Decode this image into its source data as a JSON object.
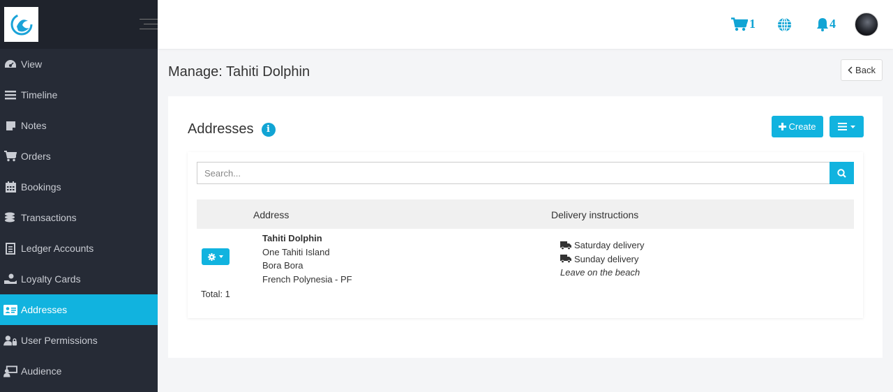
{
  "sidebar": {
    "items": [
      {
        "label": "View",
        "icon": "dashboard-icon"
      },
      {
        "label": "Timeline",
        "icon": "timeline-icon"
      },
      {
        "label": "Notes",
        "icon": "note-icon"
      },
      {
        "label": "Orders",
        "icon": "cart-icon"
      },
      {
        "label": "Bookings",
        "icon": "calendar-icon"
      },
      {
        "label": "Transactions",
        "icon": "coins-icon"
      },
      {
        "label": "Ledger Accounts",
        "icon": "ledger-icon"
      },
      {
        "label": "Loyalty Cards",
        "icon": "loyalty-icon"
      },
      {
        "label": "Addresses",
        "icon": "address-card-icon",
        "active": true
      },
      {
        "label": "User Permissions",
        "icon": "user-lock-icon"
      },
      {
        "label": "Audience",
        "icon": "audience-icon"
      }
    ]
  },
  "topbar": {
    "cart_count": "1",
    "notification_count": "4"
  },
  "page": {
    "title": "Manage: Tahiti Dolphin",
    "back_label": "Back"
  },
  "addresses": {
    "title": "Addresses",
    "create_label": "Create",
    "search_placeholder": "Search...",
    "columns": [
      "Address",
      "Delivery instructions"
    ],
    "rows": [
      {
        "name": "Tahiti Dolphin",
        "line1": "One Tahiti Island",
        "line2": "Bora Bora",
        "line3": "French Polynesia - PF",
        "delivery": [
          "Saturday delivery",
          "Sunday delivery"
        ],
        "note": "Leave on the beach"
      }
    ],
    "total": "Total: 1"
  },
  "colors": {
    "accent": "#11b3df",
    "sidebar": "#262b36"
  }
}
